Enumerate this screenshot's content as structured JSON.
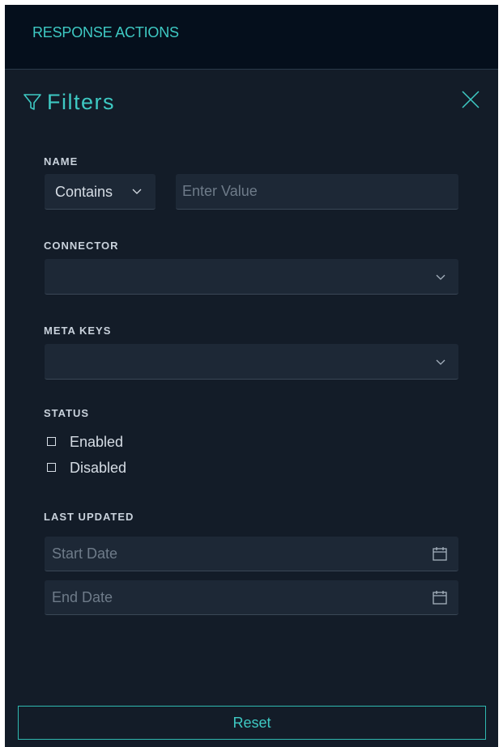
{
  "topbar": {
    "title": "RESPONSE ACTIONS"
  },
  "filters": {
    "title": "Filters",
    "icons": {
      "filter": "filter-funnel-icon",
      "close": "close-x-icon",
      "chevron": "chevron-down-icon",
      "calendar": "calendar-icon"
    },
    "name": {
      "label": "NAME",
      "operator_value": "Contains",
      "value_placeholder": "Enter Value",
      "value": ""
    },
    "connector": {
      "label": "CONNECTOR",
      "value": ""
    },
    "meta_keys": {
      "label": "META KEYS",
      "value": ""
    },
    "status": {
      "label": "STATUS",
      "options": [
        {
          "label": "Enabled",
          "checked": false
        },
        {
          "label": "Disabled",
          "checked": false
        }
      ]
    },
    "last_updated": {
      "label": "LAST UPDATED",
      "start_placeholder": "Start Date",
      "end_placeholder": "End Date"
    },
    "reset_label": "Reset"
  },
  "colors": {
    "accent": "#3ec9c3",
    "panel_bg": "#131c28",
    "topbar_bg": "#050f1c",
    "field_bg": "#1d2836",
    "text": "#d6dde5",
    "placeholder": "#6e7b89"
  }
}
